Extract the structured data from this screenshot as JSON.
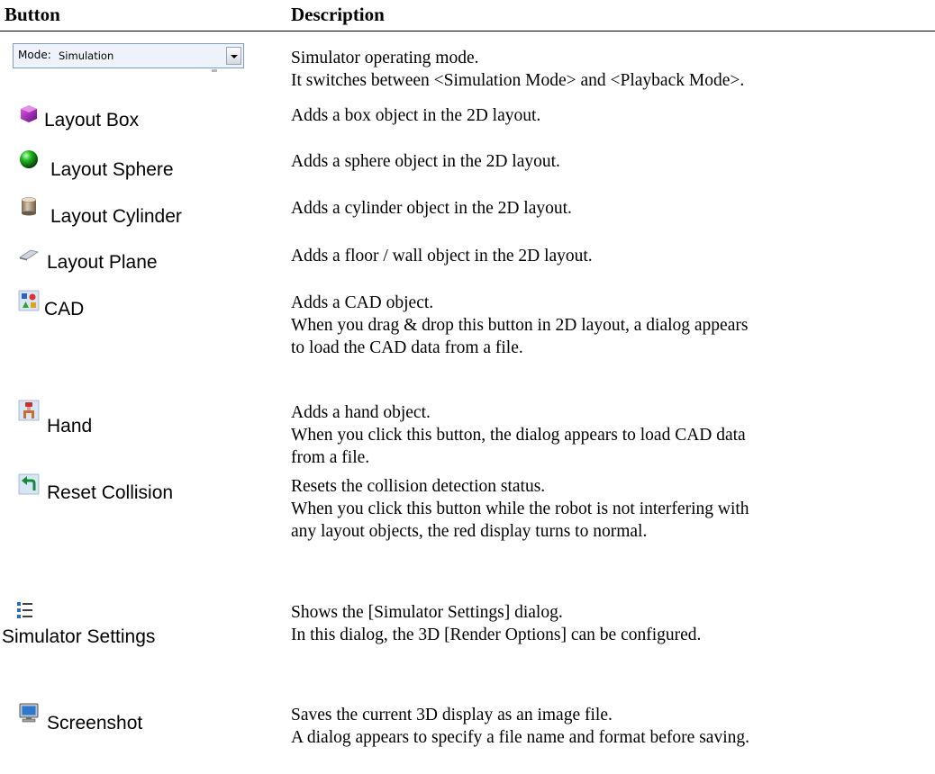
{
  "header": {
    "button_col": "Button",
    "description_col": "Description"
  },
  "mode": {
    "label": "Mode:",
    "value": "Simulation"
  },
  "rows": [
    {
      "button": "",
      "icon": "mode-dropdown",
      "desc": [
        "Simulator operating mode.",
        "It switches between <Simulation Mode> and <Playback Mode>."
      ]
    },
    {
      "button": "Layout Box",
      "icon": "purple-box-icon",
      "desc": [
        "Adds a box object in the 2D layout."
      ]
    },
    {
      "button": "Layout Sphere",
      "icon": "green-sphere-icon",
      "desc": [
        "Adds a sphere object in the 2D layout."
      ]
    },
    {
      "button": "Layout Cylinder",
      "icon": "cylinder-icon",
      "desc": [
        "Adds a cylinder object in the 2D layout."
      ]
    },
    {
      "button": "Layout Plane",
      "icon": "plane-icon",
      "desc": [
        "Adds a floor / wall object in the 2D layout."
      ]
    },
    {
      "button": "CAD",
      "icon": "cad-icon",
      "desc": [
        "Adds a CAD object.",
        "When you drag & drop this button in 2D layout, a dialog appears",
        "to load the CAD data from a file."
      ]
    },
    {
      "button": "Hand",
      "icon": "hand-icon",
      "desc": [
        "Adds a hand object.",
        "When you click this button, the dialog appears to load CAD data",
        "from a file."
      ]
    },
    {
      "button": "Reset Collision",
      "icon": "reset-arrow-icon",
      "desc": [
        "Resets the collision detection status.",
        "When you click this button while the robot is not interfering with",
        "any layout objects, the red display turns to normal."
      ]
    },
    {
      "button": "Simulator Settings",
      "icon": "settings-list-icon",
      "desc": [
        "Shows the [Simulator Settings] dialog.",
        "In this dialog, the 3D [Render Options] can be configured."
      ]
    },
    {
      "button": "Screenshot",
      "icon": "monitor-icon",
      "desc": [
        "Saves the current 3D display as an image file.",
        "A dialog appears to specify a file name and format before saving."
      ]
    }
  ]
}
